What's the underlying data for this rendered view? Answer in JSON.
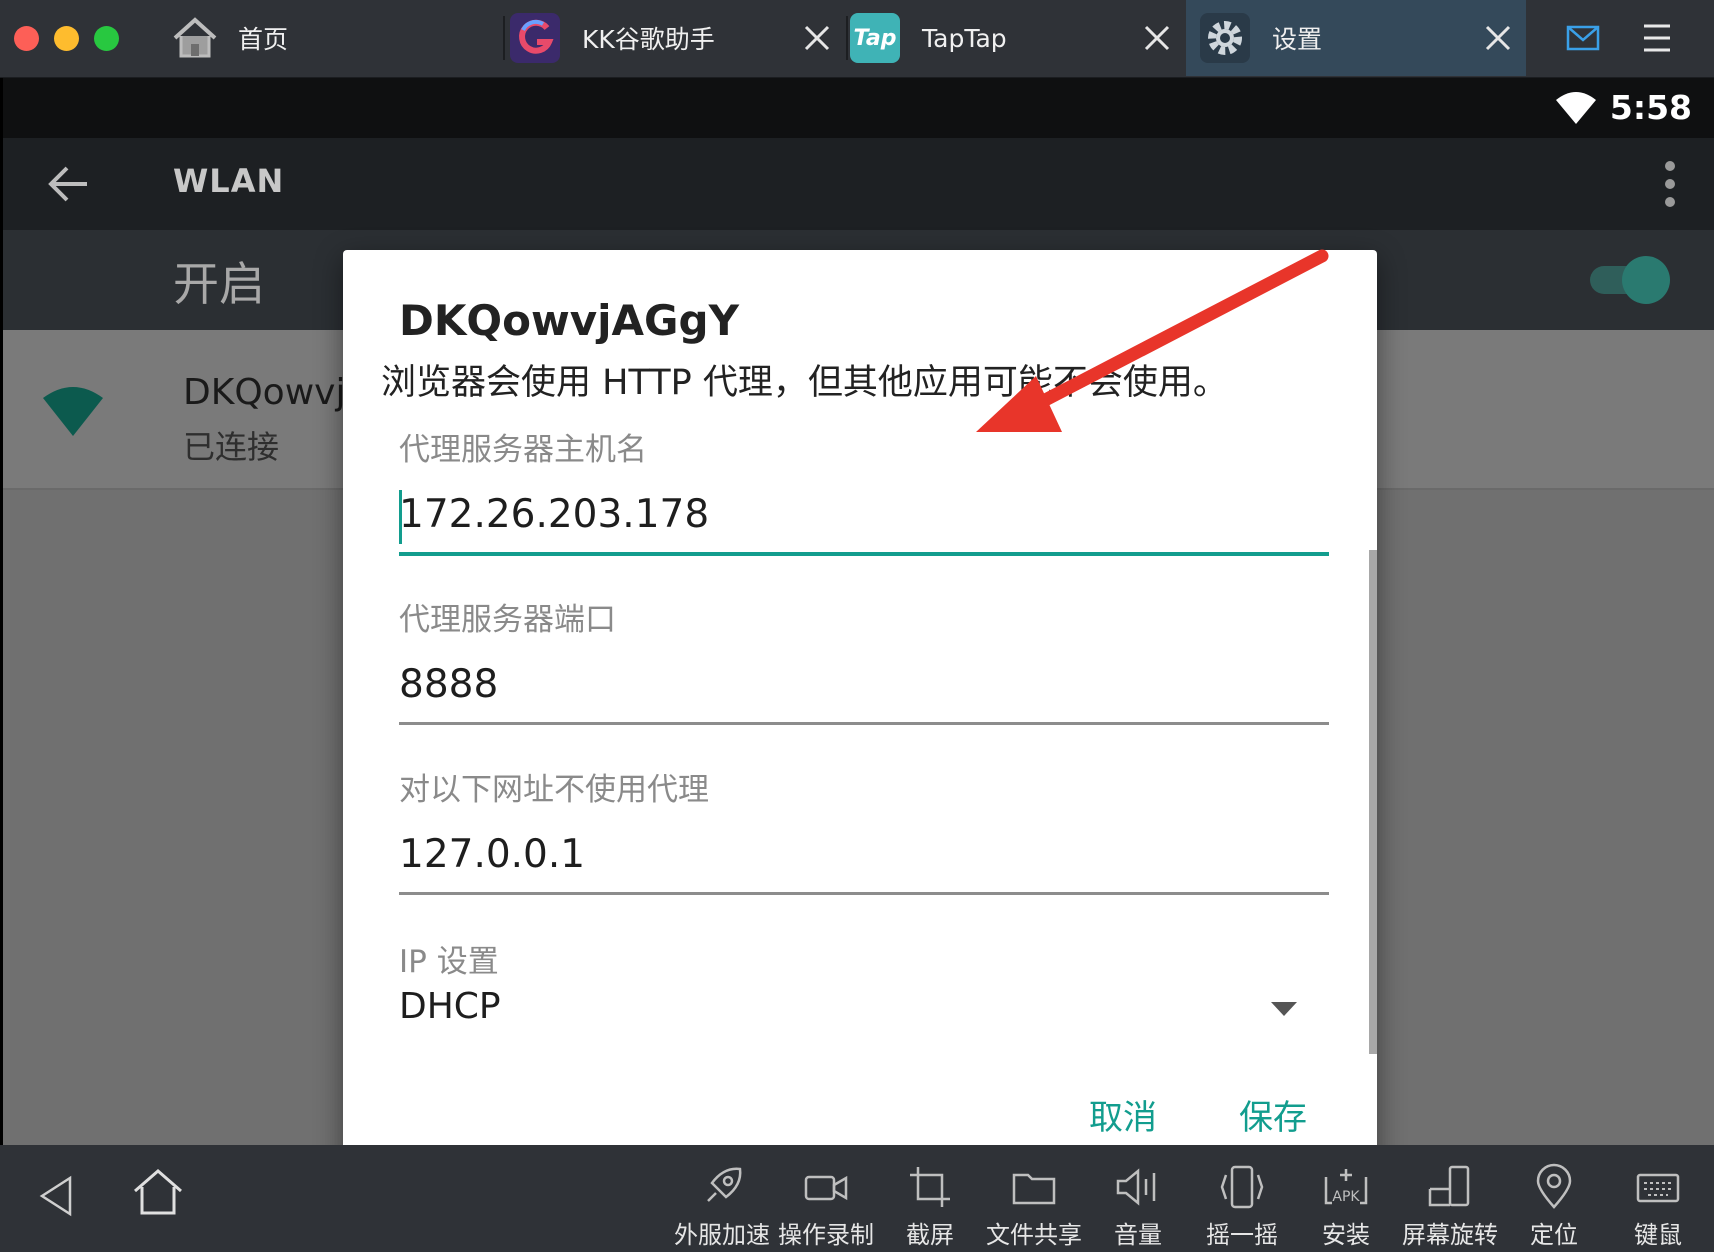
{
  "tabs": [
    {
      "label": "首页",
      "icon": "home-icon"
    },
    {
      "label": "KK谷歌助手",
      "icon": "kk-google-app-icon"
    },
    {
      "label": "TapTap",
      "icon_text": "Tap",
      "icon": "taptap-app-icon"
    },
    {
      "label": "设置",
      "icon": "gear-icon",
      "active": true
    }
  ],
  "status_bar": {
    "time": "5:58"
  },
  "wlan": {
    "title": "WLAN",
    "switch_label": "开启",
    "network_name": "DKQowvj",
    "network_status": "已连接"
  },
  "dialog": {
    "title": "DKQowvjAGgY",
    "message": "浏览器会使用 HTTP 代理，但其他应用可能不会使用。",
    "proxy_host": {
      "label": "代理服务器主机名",
      "value": "172.26.203.178"
    },
    "proxy_port": {
      "label": "代理服务器端口",
      "value": "8888"
    },
    "bypass": {
      "label": "对以下网址不使用代理",
      "value": "127.0.0.1"
    },
    "ip_settings": {
      "label": "IP 设置",
      "value": "DHCP"
    },
    "cancel_label": "取消",
    "save_label": "保存"
  },
  "toolbar": [
    {
      "label": "外服加速",
      "icon": "rocket-icon"
    },
    {
      "label": "操作录制",
      "icon": "video-camera-icon"
    },
    {
      "label": "截屏",
      "icon": "crop-icon"
    },
    {
      "label": "文件共享",
      "icon": "folder-icon"
    },
    {
      "label": "音量",
      "icon": "volume-icon"
    },
    {
      "label": "摇一摇",
      "icon": "shake-icon"
    },
    {
      "label": "安装",
      "icon": "apk-install-icon",
      "icon_text": "APK"
    },
    {
      "label": "屏幕旋转",
      "icon": "rotate-screen-icon"
    },
    {
      "label": "定位",
      "icon": "location-pin-icon"
    },
    {
      "label": "键鼠",
      "icon": "keyboard-icon"
    }
  ],
  "colors": {
    "accent": "#129d8e",
    "annotation_arrow": "#e8352a",
    "active_tab": "#34495a"
  }
}
